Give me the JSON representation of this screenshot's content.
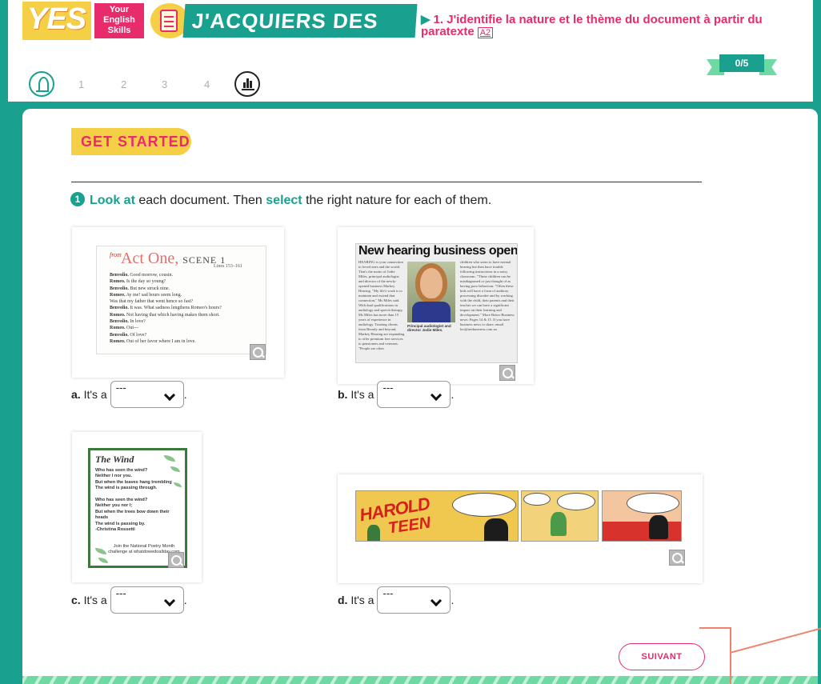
{
  "header": {
    "logo_yes": "YES",
    "logo_tag": [
      "Your",
      "English",
      "Skills"
    ],
    "strategy_title": "J'ACQUIERS DES STRATÉGIES",
    "lesson_title": "1. J'identifie la nature et le thème du document à partir du paratexte",
    "level_badge": "A2",
    "score": "0/5",
    "steps": [
      "1",
      "2",
      "3",
      "4"
    ]
  },
  "section": {
    "badge": "GET STARTED",
    "instruction": {
      "number": "1",
      "kw1": "Look at",
      "text1": " each document. Then ",
      "kw2": "select",
      "text2": " the right nature for each of them."
    }
  },
  "documents": {
    "a": {
      "from": "from",
      "title": "Act One,",
      "scene": "SCENE 1",
      "lines_ref": "Lines 153–161",
      "text": [
        [
          "Benvolio.",
          "Good morrow, cousin."
        ],
        [
          "Romeo.",
          "Is the day so young?"
        ],
        [
          "Benvolio.",
          "But new struck nine."
        ],
        [
          "Romeo.",
          "Ay me! sad hours seem long."
        ],
        [
          "",
          "Was that my father that went hence so fast?"
        ],
        [
          "Benvolio.",
          "It was. What sadness lengthens Romeo's hours?"
        ],
        [
          "Romeo.",
          "Not having that which having makes them short."
        ],
        [
          "Benvolio.",
          "In love?"
        ],
        [
          "Romeo.",
          "Out—"
        ],
        [
          "Benvolio.",
          "Of love?"
        ],
        [
          "Romeo.",
          "Out of her favor where I am in love."
        ]
      ]
    },
    "b": {
      "headline": "New hearing business opens",
      "col1": "HEARING is your connection to loved ones and the world. That's the motto of Jodie Miles, principal audiologist and director of the newly-opened business Markey Hearing. \"My life's work is to maintain and extend that connection,\" Ms Miles said. With dual qualifications in audiology and speech therapy, Ms Miles has more than 15 years of experience in audiology. Treating clients from Brearly and beyond, Markey Hearing are expanding to offer premium free services to pensioners and veterans. \"People are often",
      "caption": "Principal audiologist and director Jodie Miles.",
      "col3": "children who seem to have normal hearing but then have trouble following instructions in a noisy classroom. \"These children can be misdiagnosed or just thought of as having poor behaviour. \"Often these kids will have a form of auditory processing disorder and by working with the child, their parents and their teacher we can have a significant impact on their learning and development.\" More Better Business news: Pages 14 & 15. If you have business news to share, email leo@aesbusiness.com.au"
    },
    "c": {
      "title": "The Wind",
      "poem": [
        "Who has seen the wind?",
        "Neither I nor you.",
        "But when the leaves hang trembling",
        "The wind is passing through.",
        "",
        "Who has seen the wind?",
        "Neither you nor I;",
        "But when the trees bow down their heads",
        "The wind is passing by.",
        "-Christina Rossetti"
      ],
      "footer": "Join the National Poetry Month challenge at whatdowedoallday.com"
    },
    "d": {
      "title1": "HAROLD",
      "title2": "TEEN"
    }
  },
  "answers": {
    "a": {
      "letter": "a.",
      "prefix": "It's a",
      "value": "---"
    },
    "b": {
      "letter": "b.",
      "prefix": "It's a",
      "value": "---"
    },
    "c": {
      "letter": "c.",
      "prefix": "It's a",
      "value": "---"
    },
    "d": {
      "letter": "d.",
      "prefix": "It's a",
      "value": "---"
    }
  },
  "footer": {
    "next_label": "SUIVANT"
  },
  "colors": {
    "teal": "#1aa08f",
    "pink": "#e72b6b",
    "yellow": "#f5d046",
    "mint": "#6fd9a4"
  }
}
